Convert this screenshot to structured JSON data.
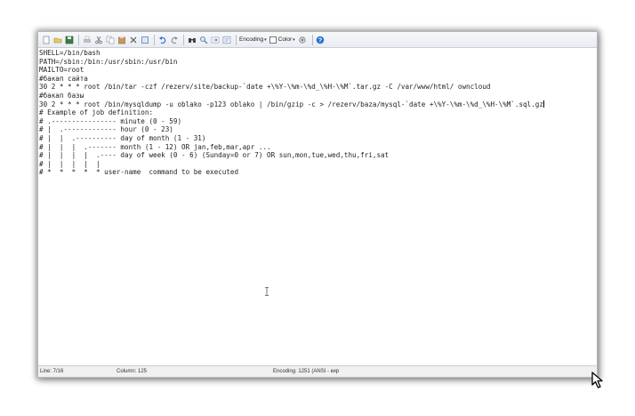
{
  "toolbar": {
    "buttons": [
      {
        "name": "new-icon"
      },
      {
        "name": "open-icon"
      },
      {
        "name": "save-icon"
      },
      {
        "name": "print-icon"
      },
      {
        "name": "cut-icon"
      },
      {
        "name": "copy-icon"
      },
      {
        "name": "paste-icon"
      },
      {
        "name": "delete-icon"
      },
      {
        "name": "select-all-icon"
      },
      {
        "name": "undo-icon"
      },
      {
        "name": "redo-icon"
      },
      {
        "name": "find-icon"
      },
      {
        "name": "replace-icon"
      },
      {
        "name": "goto-icon"
      },
      {
        "name": "wordwrap-icon"
      }
    ],
    "encoding_label": "Encoding",
    "color_label": "Color",
    "help_icon": "help-icon"
  },
  "editor": {
    "lines": [
      "SHELL=/bin/bash",
      "PATH=/sbin:/bin:/usr/sbin:/usr/bin",
      "MAILTO=root",
      "#бакап сайта",
      "30 2 * * * root /bin/tar -czf /rezerv/site/backup-`date +\\%Y-\\%m-\\%d_\\%H-\\%M`.tar.gz -C /var/www/html/ owncloud",
      "#бакап базы",
      "30 2 * * * root /bin/mysqldump -u oblako -p123 oblako | /bin/gzip -c > /rezerv/baza/mysql-`date +\\%Y-\\%m-\\%d_\\%H-\\%M`.sql.gz",
      "# Example of job definition:",
      "# .---------------- minute (0 - 59)",
      "# |  .------------- hour (0 - 23)",
      "# |  |  .---------- day of month (1 - 31)",
      "# |  |  |  .------- month (1 - 12) OR jan,feb,mar,apr ...",
      "# |  |  |  |  .---- day of week (0 - 6) (Sunday=0 or 7) OR sun,mon,tue,wed,thu,fri,sat",
      "# |  |  |  |  |",
      "# *  *  *  *  * user-name  command to be executed"
    ]
  },
  "statusbar": {
    "line": "Line: 7/16",
    "column": "Column: 125",
    "encoding": "Encoding: 1251 (ANSI - кир"
  }
}
